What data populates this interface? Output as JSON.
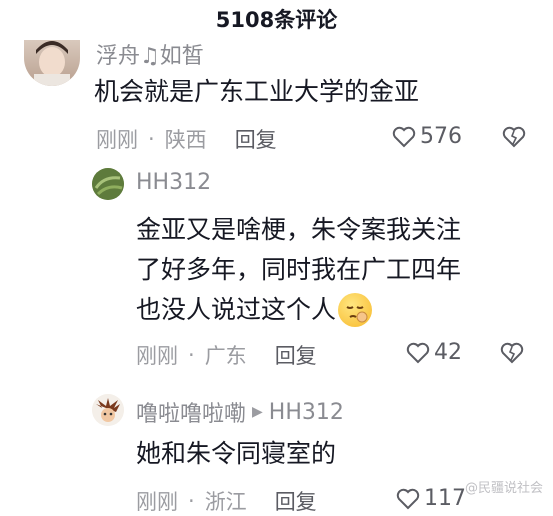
{
  "header": {
    "title": "5108条评论"
  },
  "comments": [
    {
      "username": "浮舟♫如皙",
      "text": "机会就是广东工业大学的金亚",
      "time": "刚刚",
      "location": "陕西",
      "reply_label": "回复",
      "likes": "576"
    },
    {
      "username": "HH312",
      "text_lines": [
        "金亚又是啥梗，朱令案我关注",
        "了好多年，同时我在广工四年",
        "也没人说过这个人"
      ],
      "time": "刚刚",
      "location": "广东",
      "reply_label": "回复",
      "likes": "42"
    },
    {
      "username": "噜啦噜啦嘞",
      "reply_to": "HH312",
      "text": "她和朱令同寝室的",
      "time": "刚刚",
      "location": "浙江",
      "reply_label": "回复",
      "likes": "117"
    }
  ],
  "separator_dot": "·",
  "watermark": "@民疆说社会",
  "colors": {
    "text": "#161823",
    "secondary": "#8a8b91",
    "meta": "#9b9ca1"
  }
}
